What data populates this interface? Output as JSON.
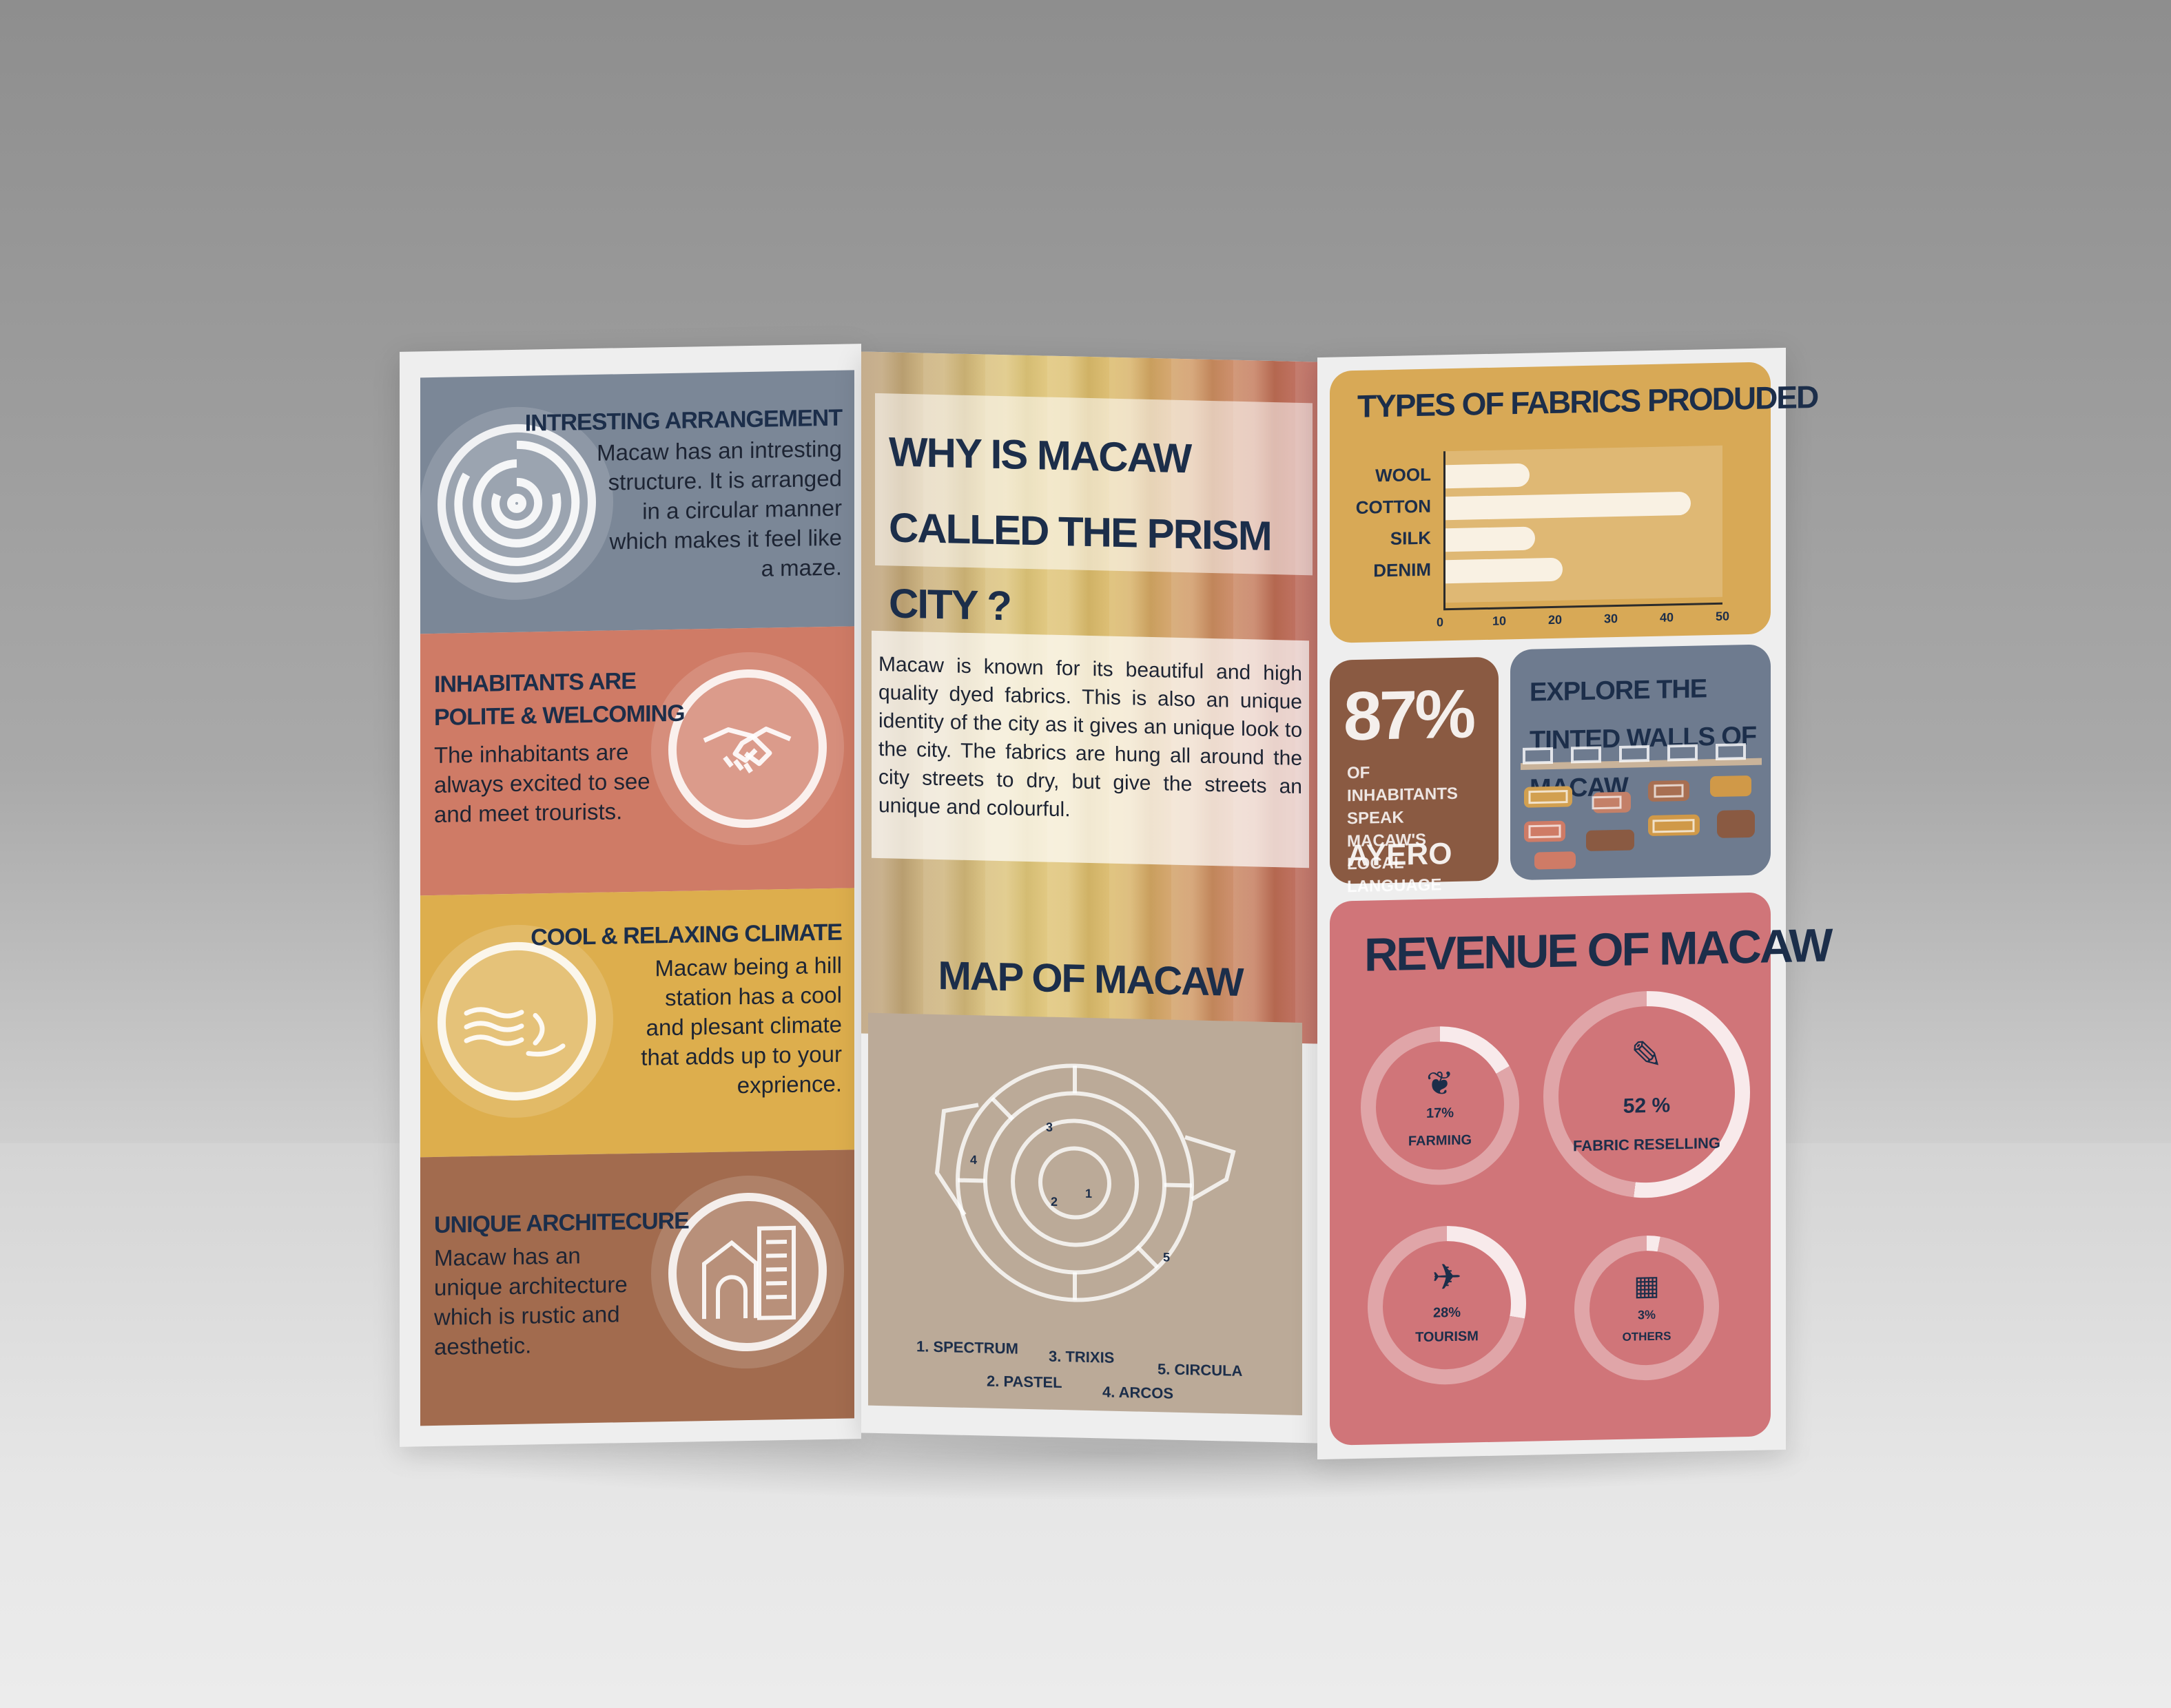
{
  "left": {
    "sections": [
      {
        "title": "INTRESTING ARRANGEMENT",
        "body": "Macaw has an intresting structure. It is arranged in a circular manner which makes it feel like a maze.",
        "icon": "maze-icon",
        "color": "#7b8797"
      },
      {
        "title": "INHABITANTS ARE POLITE & WELCOMING",
        "body": "The inhabitants are always excited to see and meet trourists.",
        "icon": "handshake-icon",
        "color": "#cf7b66"
      },
      {
        "title": "COOL & RELAXING CLIMATE",
        "body": "Macaw  being a hill station has a cool and plesant climate that adds up to your exprience.",
        "icon": "wind-face-icon",
        "color": "#ddae4d"
      },
      {
        "title": "UNIQUE ARCHITECURE",
        "body": "Macaw has an unique architecture which is rustic and aesthetic.",
        "icon": "buildings-icon",
        "color": "#a26b4e"
      }
    ]
  },
  "middle": {
    "headline": "WHY IS MACAW CALLED THE PRISM CITY ?",
    "paragraph": "Macaw is known for its beautiful and high quality dyed fabrics. This is also an unique identity of the city as it gives an unique look to the city. The fabrics are hung all around the city streets to dry, but give the streets an unique and colourful.",
    "map_title": "MAP OF MACAW",
    "map_numbers": [
      "1",
      "2",
      "3",
      "4",
      "5"
    ],
    "legend": [
      "1. SPECTRUM",
      "2. PASTEL",
      "3. TRIXIS",
      "4. ARCOS",
      "5. CIRCULA"
    ]
  },
  "right": {
    "fabrics_title": "TYPES OF FABRICS PRODUDED",
    "stat_value": "87%",
    "stat_caption": "OF INHABITANTS SPEAK MACAW'S LOCAL LANGUAGE",
    "stat_language": "AYERO",
    "walls_title": "EXPLORE THE TINTED WALLS OF MACAW",
    "revenue_title": "REVENUE OF MACAW",
    "revenue": [
      {
        "label": "FARMING",
        "value": "17%",
        "pct": 17,
        "icon": "leaf-icon"
      },
      {
        "label": "FABRIC RESELLING",
        "value": "52 %",
        "pct": 52,
        "icon": "fabric-icon"
      },
      {
        "label": "TOURISM",
        "value": "28%",
        "pct": 28,
        "icon": "airplane-icon"
      },
      {
        "label": "OTHERS",
        "value": "3%",
        "pct": 3,
        "icon": "building-icon"
      }
    ]
  },
  "chart_data": {
    "type": "bar",
    "orientation": "horizontal",
    "categories": [
      "WOOL",
      "COTTON",
      "SILK",
      "DENIM"
    ],
    "values": [
      15,
      44,
      16,
      21
    ],
    "title": "TYPES OF FABRICS PRODUDED",
    "xticks": [
      "0",
      "10",
      "20",
      "30",
      "40",
      "50"
    ],
    "xlim": [
      0,
      50
    ]
  }
}
